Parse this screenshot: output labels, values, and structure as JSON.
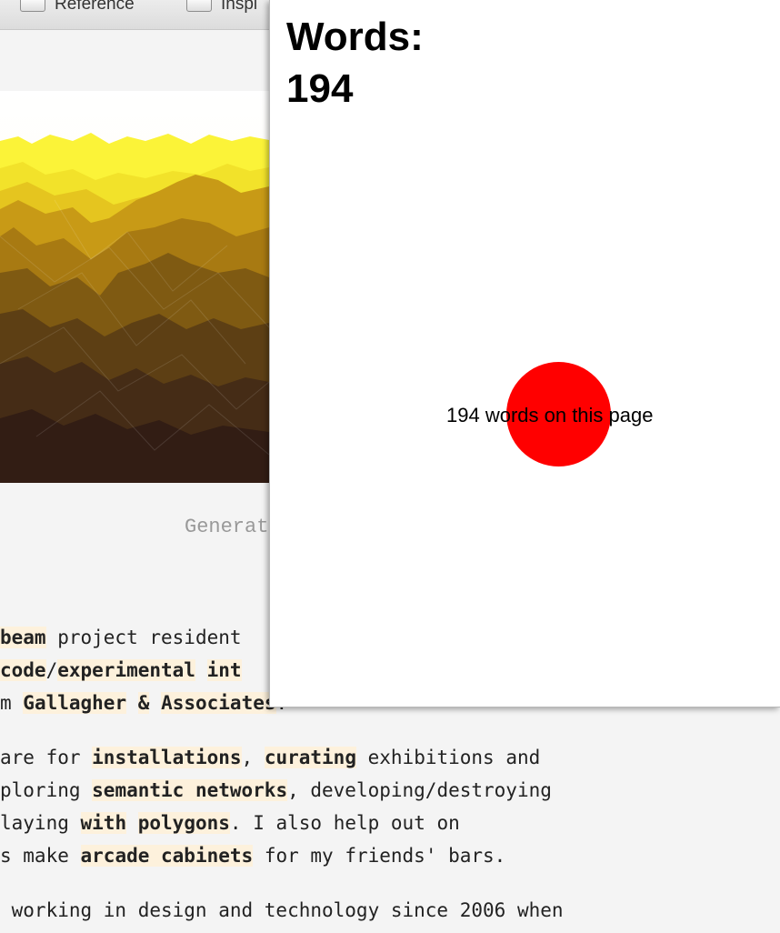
{
  "browser": {
    "bookmarks": [
      {
        "label": "Reference",
        "icon": "checkbox-icon"
      },
      {
        "label": "Inspi",
        "icon": "checkbox-icon"
      }
    ]
  },
  "page": {
    "caption": "Generat",
    "paragraph1": {
      "lines": [
        [
          {
            "t": "beam",
            "b": true
          },
          {
            "t": " project resident",
            "b": false
          }
        ],
        [
          {
            "t": "code",
            "b": true
          },
          {
            "t": "/",
            "b": false
          },
          {
            "t": "experimental",
            "b": true
          },
          {
            "t": " ",
            "b": false
          },
          {
            "t": "int",
            "b": true
          }
        ],
        [
          {
            "t": "m ",
            "b": false
          },
          {
            "t": "Gallagher",
            "b": true
          },
          {
            "t": " ",
            "b": false
          },
          {
            "t": "&",
            "b": true
          },
          {
            "t": " ",
            "b": false
          },
          {
            "t": "Associates",
            "b": true
          },
          {
            "t": ".",
            "b": false
          }
        ]
      ]
    },
    "paragraph2": {
      "lines": [
        [
          {
            "t": "are for ",
            "b": false
          },
          {
            "t": "installations",
            "b": true
          },
          {
            "t": ", ",
            "b": false
          },
          {
            "t": "curating",
            "b": true
          },
          {
            "t": " exhibitions and",
            "b": false
          }
        ],
        [
          {
            "t": "ploring ",
            "b": false
          },
          {
            "t": "semantic networks",
            "b": true
          },
          {
            "t": ", developing/destroying",
            "b": false
          }
        ],
        [
          {
            "t": "laying ",
            "b": false
          },
          {
            "t": "with",
            "b": true
          },
          {
            "t": " ",
            "b": false
          },
          {
            "t": "polygons",
            "b": true
          },
          {
            "t": ". I also help out on",
            "b": false
          }
        ],
        [
          {
            "t": "s make ",
            "b": false
          },
          {
            "t": "arcade cabinets",
            "b": true
          },
          {
            "t": " for my friends' bars.",
            "b": false
          }
        ]
      ]
    },
    "paragraph3": {
      "lines": [
        [
          {
            "t": " working in design and technology since 2006 when",
            "b": false
          }
        ]
      ]
    }
  },
  "popup": {
    "title_line1": "Words:",
    "title_line2": "194",
    "count_text": "194 words on this page",
    "circle_color": "#ff0000"
  }
}
